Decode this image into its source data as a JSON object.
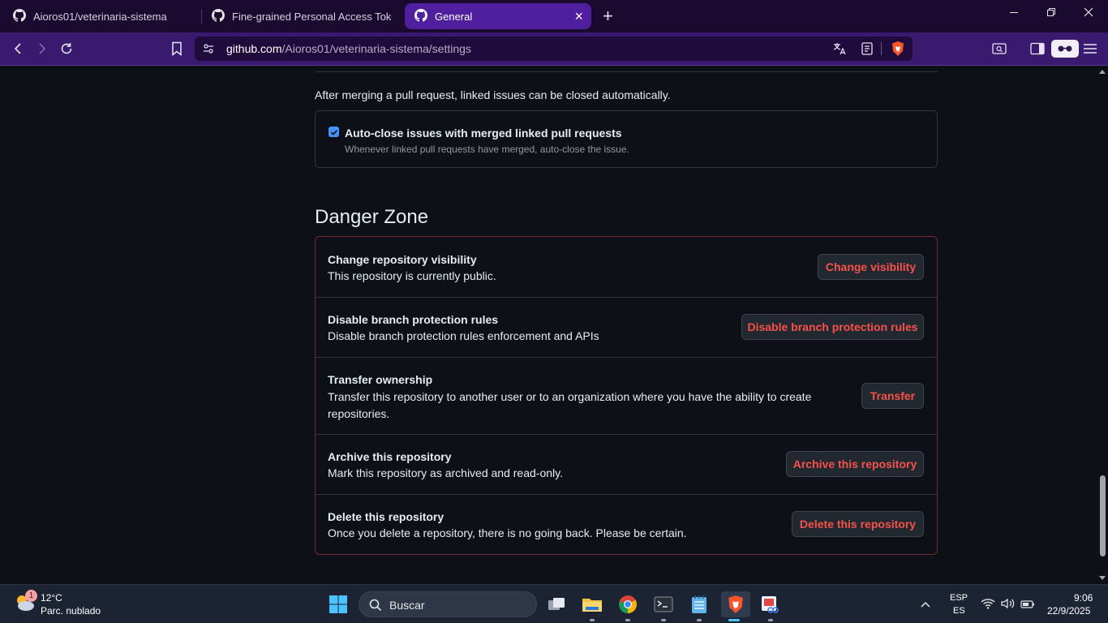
{
  "browser": {
    "tabs": [
      {
        "title": "Aioros01/veterinaria-sistema",
        "active": false
      },
      {
        "title": "Fine-grained Personal Access Tokens",
        "active": false
      },
      {
        "title": "General",
        "active": true
      }
    ],
    "url_host": "github.com",
    "url_path": "/Aioros01/veterinaria-sistema/settings",
    "accent_color": "#4f1fa0"
  },
  "issues_section": {
    "note": "After merging a pull request, linked issues can be closed automatically.",
    "autoclose": {
      "label": "Auto-close issues with merged linked pull requests",
      "description": "Whenever linked pull requests have merged, auto-close the issue.",
      "checked": true
    }
  },
  "danger_zone": {
    "title": "Danger Zone",
    "rows": [
      {
        "title": "Change repository visibility",
        "description": "This repository is currently public.",
        "button": "Change visibility"
      },
      {
        "title": "Disable branch protection rules",
        "description": "Disable branch protection rules enforcement and APIs",
        "button": "Disable branch protection rules"
      },
      {
        "title": "Transfer ownership",
        "description": "Transfer this repository to another user or to an organization where you have the ability to create repositories.",
        "button": "Transfer"
      },
      {
        "title": "Archive this repository",
        "description": "Mark this repository as archived and read-only.",
        "button": "Archive this repository"
      },
      {
        "title": "Delete this repository",
        "description": "Once you delete a repository, there is no going back. Please be certain.",
        "button": "Delete this repository"
      }
    ],
    "danger_color": "#f85149"
  },
  "taskbar": {
    "weather_temp": "12°C",
    "weather_desc": "Parc. nublado",
    "weather_badge": "1",
    "search_placeholder": "Buscar",
    "lang_primary": "ESP",
    "lang_secondary": "ES",
    "time": "9:06",
    "date": "22/9/2025",
    "apps": [
      "task-view-icon",
      "file-explorer-icon",
      "chrome-icon",
      "terminal-icon",
      "notepad-icon",
      "brave-icon",
      "snipping-tool-icon"
    ]
  }
}
